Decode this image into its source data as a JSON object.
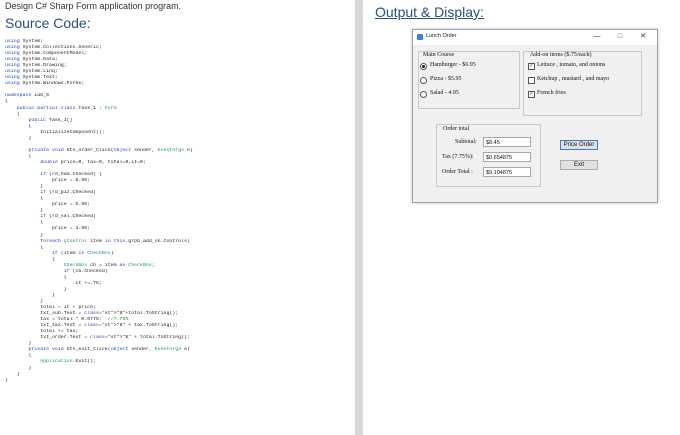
{
  "left": {
    "task": "Design C# Sharp Form application program.",
    "heading": "Source Code:",
    "code_lines": [
      "using System;",
      "using System.Collections.Generic;",
      "using System.ComponentModel;",
      "using System.Data;",
      "using System.Drawing;",
      "using System.Linq;",
      "using System.Text;",
      "using System.Windows.Forms;",
      "",
      "namespace Lab_5",
      "{",
      "    public partial class Task_1 : Form",
      "    {",
      "        public Task_1()",
      "        {",
      "            InitializeComponent();",
      "        }",
      "",
      "        private void btn_order_Click(object sender, EventArgs e)",
      "        {",
      "            double price=0, tax=0, total=0,it=0;",
      "",
      "            if (rd_ham.Checked) {",
      "                price = 6.95;",
      "            }",
      "            if (rd_piz.Checked)",
      "            {",
      "                price = 5.95;",
      "            }",
      "            if (rd_sal.Checked)",
      "            {",
      "                price = 4.95;",
      "            }",
      "            foreach (Control item in this.grpb_add_on.Controls)",
      "            {",
      "                if (item is CheckBox)",
      "                {",
      "                    CheckBox cb = item as CheckBox;",
      "                    if (cb.Checked)",
      "                    {",
      "                        it +=.75;",
      "                    }",
      "                }",
      "            }",
      "            total = it + price;",
      "            txt_sub.Text = \"$\"+total.ToString();",
      "            tax = total * 0.0775;  //7.75%",
      "            txt_tax.Text = \"$\" + tax.ToString();",
      "            total += tax;",
      "            txt_order.Text = \"$\" + total.ToString();",
      "        }",
      "        private void btn_exit_Click(object sender, EventArgs e)",
      "        {",
      "            Application.Exit();",
      "        }",
      "    }",
      "}"
    ]
  },
  "right": {
    "heading": "Output & Display:",
    "window": {
      "title": "Lunch Order",
      "minimize": "—",
      "maximize": "□",
      "close": "✕",
      "main_course": {
        "label": "Main Course",
        "options": [
          {
            "label": "Hamburger - $6.95",
            "checked": true
          },
          {
            "label": "Pizza - $5.95",
            "checked": false
          },
          {
            "label": "Salad - 4.95",
            "checked": false
          }
        ]
      },
      "add_on": {
        "label": "Add-on items ($.75/each)",
        "options": [
          {
            "label": "Lettuce , tomato, and onions",
            "checked": true
          },
          {
            "label": "Ketchup , mustard , and mayo",
            "checked": false
          },
          {
            "label": "French fries",
            "checked": true
          }
        ]
      },
      "order_total": {
        "label": "Order total",
        "subtotal_label": "Subtotal:",
        "subtotal_value": "$8.45",
        "tax_label": "Tax (7.75%):",
        "tax_value": "$0.654875",
        "total_label": "Order Total :",
        "total_value": "$9.104875"
      },
      "price_order_button": "Price Order",
      "exit_button": "Exit",
      "check_mark": "✓"
    }
  }
}
